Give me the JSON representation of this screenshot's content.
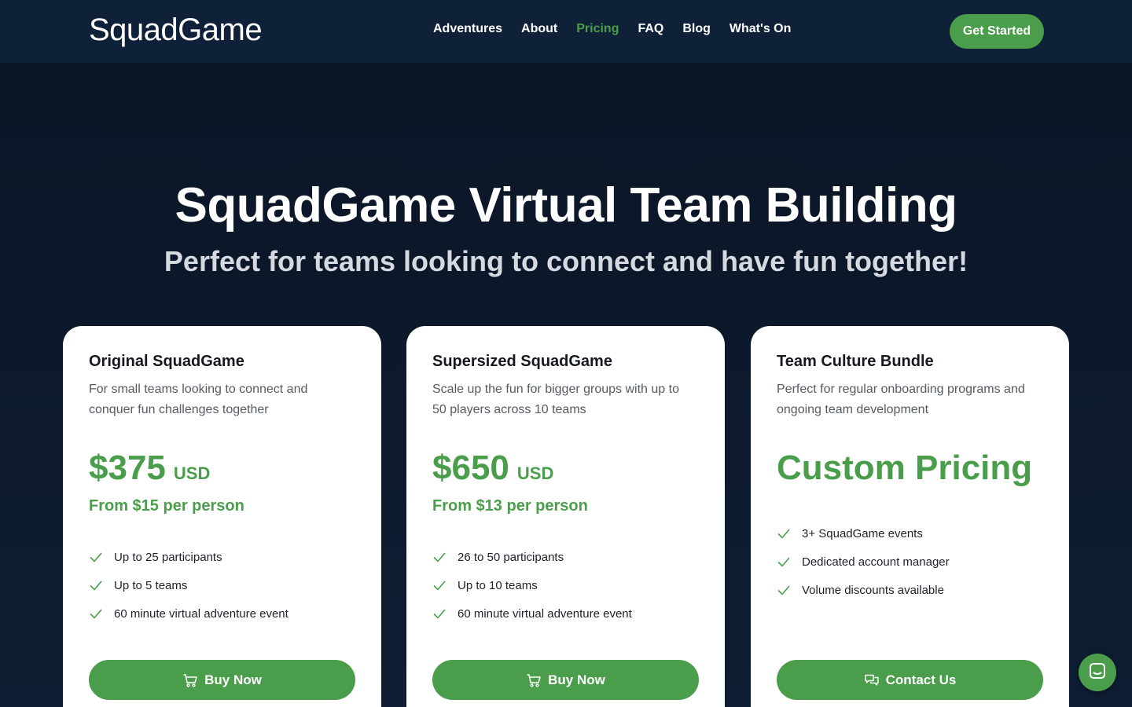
{
  "brand": {
    "logo_text": "SquadGame"
  },
  "nav": {
    "links": [
      {
        "label": "Adventures",
        "active": false
      },
      {
        "label": "About",
        "active": false
      },
      {
        "label": "Pricing",
        "active": true
      },
      {
        "label": "FAQ",
        "active": false
      },
      {
        "label": "Blog",
        "active": false
      },
      {
        "label": "What's On",
        "active": false
      }
    ],
    "cta_label": "Get Started"
  },
  "hero": {
    "title": "SquadGame Virtual Team Building",
    "subtitle": "Perfect for teams looking to connect and have fun together!"
  },
  "plans": [
    {
      "title": "Original SquadGame",
      "description": "For small teams looking to connect and conquer fun challenges together",
      "price": "$375",
      "currency": "USD",
      "per_person": "From $15 per person",
      "features": [
        "Up to 25 participants",
        "Up to 5 teams",
        "60 minute virtual adventure event"
      ],
      "button_label": "Buy Now",
      "button_icon": "cart-icon"
    },
    {
      "title": "Supersized SquadGame",
      "description": "Scale up the fun for bigger groups with up to 50 players across 10 teams",
      "price": "$650",
      "currency": "USD",
      "per_person": "From $13 per person",
      "features": [
        "26 to 50 participants",
        "Up to 10 teams",
        "60 minute virtual adventure event"
      ],
      "button_label": "Buy Now",
      "button_icon": "cart-icon"
    },
    {
      "title": "Team Culture Bundle",
      "description": "Perfect for regular onboarding programs and ongoing team development",
      "custom_price": "Custom Pricing",
      "features": [
        "3+ SquadGame events",
        "Dedicated account manager",
        "Volume discounts available"
      ],
      "button_label": "Contact Us",
      "button_icon": "chat-bubbles-icon"
    }
  ],
  "colors": {
    "accent": "#4a9e4b",
    "nav_bg": "#0f2138",
    "hero_bg": "#0d1828",
    "card_bg": "#ffffff"
  },
  "chat_launcher": {
    "icon": "chat-icon"
  }
}
